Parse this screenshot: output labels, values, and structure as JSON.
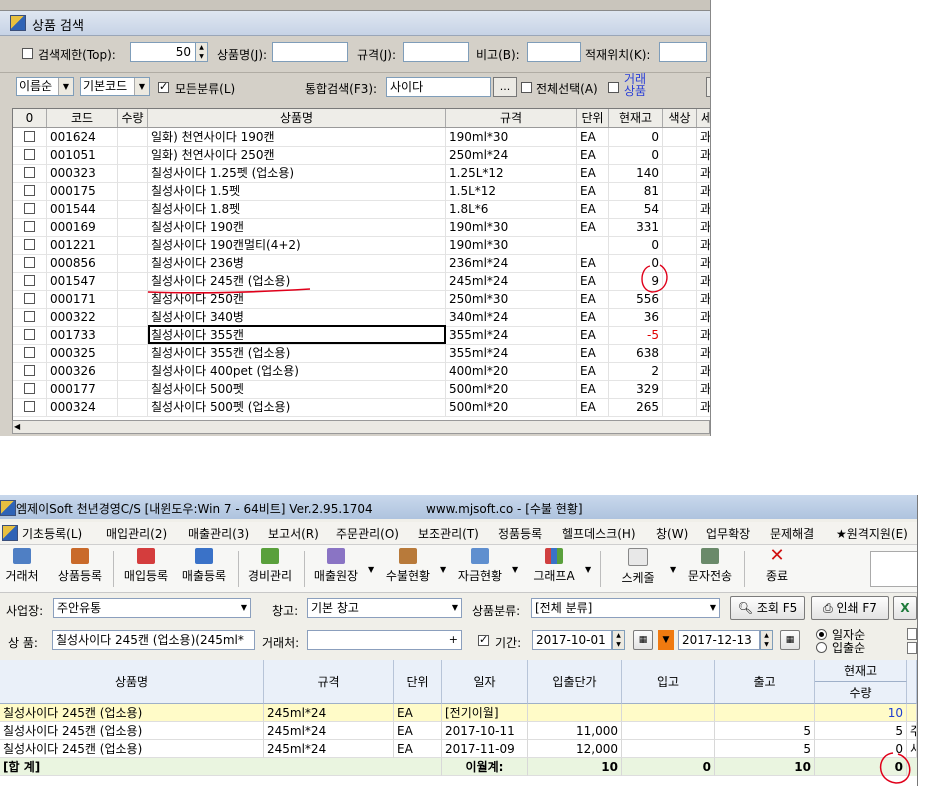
{
  "search_window": {
    "title": "상품 검색",
    "options": {
      "top_limit_label": "검색제한(Top):",
      "top_limit_value": "50",
      "product_name_label": "상품명(J):",
      "spec_label": "규격(J):",
      "note_label": "비고(B):",
      "location_label": "적재위치(K):"
    },
    "filters": {
      "sort_select": "이름순",
      "code_select": "기본코드",
      "all_category_label": "모든분류(L)",
      "unified_search_label": "통합검색(F3):",
      "unified_search_value": "사이다",
      "browse_button": "...",
      "select_all_label": "전체선택(A)",
      "trade_goods_label_1": "거래",
      "trade_goods_label_2": "상품"
    },
    "grid": {
      "headers": [
        "0",
        "코드",
        "수량",
        "상품명",
        "규격",
        "단위",
        "현재고",
        "색상",
        "세"
      ],
      "rows": [
        {
          "code": "001624",
          "name": "일화) 천연사이다 190캔",
          "spec": "190ml*30",
          "unit": "EA",
          "stock": "0",
          "extra": "과"
        },
        {
          "code": "001051",
          "name": "일화) 천연사이다 250캔",
          "spec": "250ml*24",
          "unit": "EA",
          "stock": "0",
          "extra": "과"
        },
        {
          "code": "000323",
          "name": "칠성사이다 1.25펫 (업소용)",
          "spec": "1.25L*12",
          "unit": "EA",
          "stock": "140",
          "extra": "과"
        },
        {
          "code": "000175",
          "name": "칠성사이다 1.5펫",
          "spec": "1.5L*12",
          "unit": "EA",
          "stock": "81",
          "extra": "과"
        },
        {
          "code": "001544",
          "name": "칠성사이다 1.8펫",
          "spec": "1.8L*6",
          "unit": "EA",
          "stock": "54",
          "extra": "과"
        },
        {
          "code": "000169",
          "name": "칠성사이다 190캔",
          "spec": "190ml*30",
          "unit": "EA",
          "stock": "331",
          "extra": "과"
        },
        {
          "code": "001221",
          "name": "칠성사이다 190캔멀티(4+2)",
          "spec": "190ml*30",
          "unit": "",
          "stock": "0",
          "extra": "과"
        },
        {
          "code": "000856",
          "name": "칠성사이다 236병",
          "spec": "236ml*24",
          "unit": "EA",
          "stock": "0",
          "extra": "과"
        },
        {
          "code": "001547",
          "name": "칠성사이다 245캔 (업소용)",
          "spec": "245ml*24",
          "unit": "EA",
          "stock": "9",
          "extra": "과"
        },
        {
          "code": "000171",
          "name": "칠성사이다 250캔",
          "spec": "250ml*30",
          "unit": "EA",
          "stock": "556",
          "extra": "과"
        },
        {
          "code": "000322",
          "name": "칠성사이다 340병",
          "spec": "340ml*24",
          "unit": "EA",
          "stock": "36",
          "extra": "과"
        },
        {
          "code": "001733",
          "name": "칠성사이다 355캔",
          "spec": "355ml*24",
          "unit": "EA",
          "stock": "-5",
          "extra": "과"
        },
        {
          "code": "000325",
          "name": "칠성사이다 355캔 (업소용)",
          "spec": "355ml*24",
          "unit": "EA",
          "stock": "638",
          "extra": "과"
        },
        {
          "code": "000326",
          "name": "칠성사이다 400pet (업소용)",
          "spec": "400ml*20",
          "unit": "EA",
          "stock": "2",
          "extra": "과"
        },
        {
          "code": "000177",
          "name": "칠성사이다 500펫",
          "spec": "500ml*20",
          "unit": "EA",
          "stock": "329",
          "extra": "과"
        },
        {
          "code": "000324",
          "name": "칠성사이다 500펫 (업소용)",
          "spec": "500ml*20",
          "unit": "EA",
          "stock": "265",
          "extra": "과"
        }
      ]
    }
  },
  "stock_window": {
    "title": "엠제이Soft 천년경영C/S [내윈도우:Win 7 - 64비트] Ver.2.95.1704",
    "url_title": "www.mjsoft.co - [수불 현황]",
    "menu": [
      "기초등록(L)",
      "매입관리(2)",
      "매출관리(3)",
      "보고서(R)",
      "주문관리(O)",
      "보조관리(T)",
      "정품등록",
      "헬프데스크(H)",
      "창(W)",
      "업무확장",
      "문제해결",
      "★원격지원(E)"
    ],
    "toolbar": [
      "거래처",
      "상품등록",
      "매입등록",
      "매출등록",
      "경비관리",
      "매출원장",
      "수불현황",
      "자금현황",
      "그래프A",
      "스케줄",
      "문자전송",
      "종료"
    ],
    "filters": {
      "business_label": "사업장:",
      "business_value": "주안유통",
      "warehouse_label": "창고:",
      "warehouse_value": "기본 창고",
      "category_label": "상품분류:",
      "category_value": "[전체 분류]",
      "search_button": "조회 F5",
      "print_button": "인쇄 F7",
      "product_label": "상  품:",
      "product_value": "칠성사이다 245캔 (업소용)(245ml*",
      "client_label": "거래처:",
      "client_value": "",
      "period_label": "기간:",
      "date_from": "2017-10-01",
      "date_to": "2017-12-13",
      "radio_daily": "일자순",
      "radio_inout": "입출순"
    },
    "grid": {
      "headers": [
        "상품명",
        "규격",
        "단위",
        "일자",
        "입출단가",
        "입고",
        "출고",
        "현재고",
        "수량"
      ],
      "rows": [
        {
          "name": "칠성사이다 245캔 (업소용)",
          "spec": "245ml*24",
          "unit": "EA",
          "date": "[전기이월]",
          "price": "",
          "in": "",
          "out": "",
          "qty": "10",
          "extra": ""
        },
        {
          "name": "칠성사이다 245캔 (업소용)",
          "spec": "245ml*24",
          "unit": "EA",
          "date": "2017-10-11",
          "price": "11,000",
          "in": "",
          "out": "5",
          "qty": "5",
          "extra": "주"
        },
        {
          "name": "칠성사이다 245캔 (업소용)",
          "spec": "245ml*24",
          "unit": "EA",
          "date": "2017-11-09",
          "price": "12,000",
          "in": "",
          "out": "5",
          "qty": "0",
          "extra": "서"
        }
      ],
      "total": {
        "label": "[합 계]",
        "carry_label": "이월계:",
        "price": "10",
        "in": "0",
        "out": "10",
        "qty": "0"
      }
    }
  },
  "colors": {
    "negative": "#e00000",
    "annotation": "#e0001a",
    "carry_row": "#fffbc8",
    "total_row": "#eaf5e0"
  }
}
